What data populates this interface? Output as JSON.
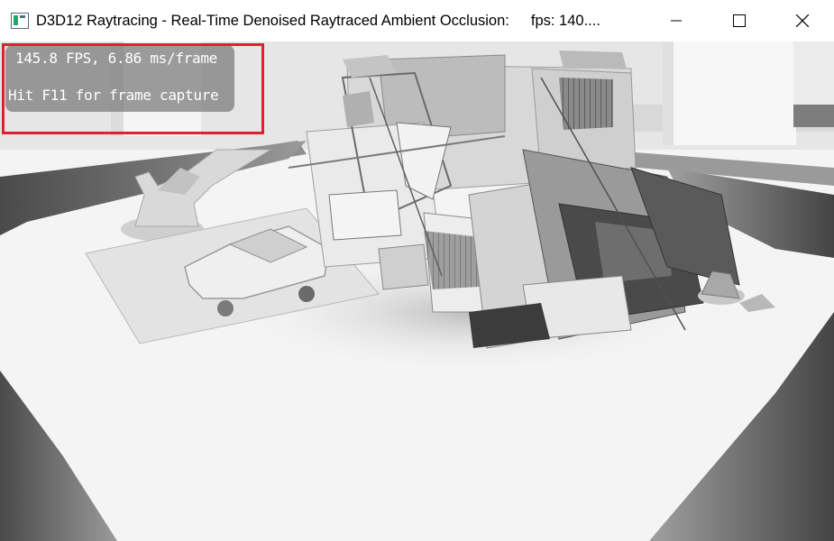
{
  "window": {
    "title": "D3D12 Raytracing - Real-Time Denoised Raytraced Ambient Occlusion:",
    "title_fps": "fps: 140....",
    "icons": {
      "app": "directx-app-icon",
      "minimize": "minimize-icon",
      "maximize": "maximize-icon",
      "close": "close-icon"
    }
  },
  "overlay": {
    "fps_line": "145.8 FPS, 6.86 ms/frame",
    "hint_line": "Hit F11 for frame capture",
    "highlight_color": "#e0202c"
  },
  "scene": {
    "description_colors": {
      "ground": "#f4f4f4",
      "grass": "#6e6e6e",
      "pillar": "#f0f0f0"
    }
  }
}
